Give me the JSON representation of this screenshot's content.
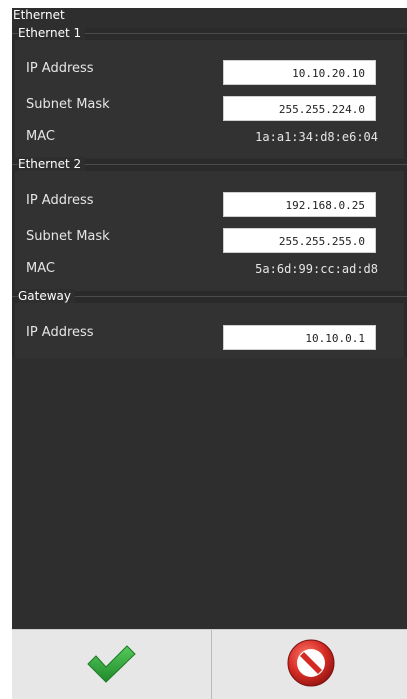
{
  "panel": {
    "title": "Ethernet"
  },
  "ethernet1": {
    "title": "Ethernet 1",
    "ip_label": "IP Address",
    "ip_value": "10.10.20.10",
    "mask_label": "Subnet Mask",
    "mask_value": "255.255.224.0",
    "mac_label": "MAC",
    "mac_value": "1a:a1:34:d8:e6:04"
  },
  "ethernet2": {
    "title": "Ethernet 2",
    "ip_label": "IP Address",
    "ip_value": "192.168.0.25",
    "mask_label": "Subnet Mask",
    "mask_value": "255.255.255.0",
    "mac_label": "MAC",
    "mac_value": "5a:6d:99:cc:ad:d8"
  },
  "gateway": {
    "title": "Gateway",
    "ip_label": "IP Address",
    "ip_value": "10.10.0.1"
  },
  "footer": {
    "confirm_icon": "checkmark-icon",
    "cancel_icon": "cancel-icon",
    "colors": {
      "confirm": "#2fa43a",
      "cancel": "#d32a2a"
    }
  }
}
